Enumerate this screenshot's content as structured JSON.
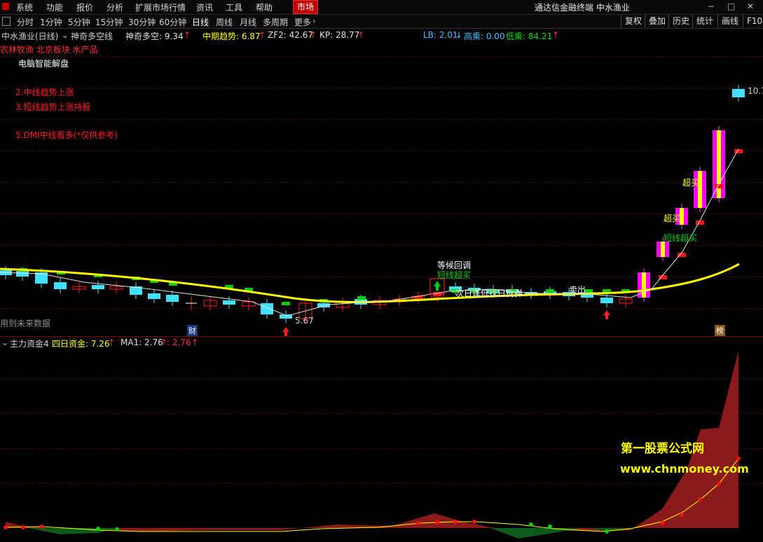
{
  "menu": {
    "items": [
      "系统",
      "功能",
      "报价",
      "分析",
      "扩展市场行情",
      "资讯",
      "工具",
      "帮助"
    ],
    "market": "市场",
    "app_title": "通达信金融终端  中水渔业"
  },
  "periods": [
    "分时",
    "1分钟",
    "5分钟",
    "15分钟",
    "30分钟",
    "60分钟",
    "日线",
    "周线",
    "月线",
    "多周期",
    "更多"
  ],
  "active_period": "日线",
  "right_tools": [
    "复权",
    "叠加",
    "历史",
    "统计",
    "画线",
    "F10"
  ],
  "stock": {
    "name": "中水渔业(日线)",
    "indicator": "神奇多空线",
    "shenqi": "神奇多空: 9.34",
    "zhongqi": "中期趋势: 6.87",
    "zf2": "ZF2: 42.67",
    "kp": "KP: 28.77",
    "lb": "LB: 2.01",
    "gaocheng": "高乘: 0.00",
    "dicheng": "低乘: 84.21",
    "sectors": "农林牧渔 北京板块 水产品"
  },
  "annotations": {
    "computer": "电脑智能解盘",
    "line2": "2.中线趋势上涨",
    "line3": "3.短线趋势上涨持股",
    "line5": "5.DMI中线看多(*仅供参考)",
    "future": "用到未来数据",
    "low_price": "5.67",
    "high_price": "10.7",
    "dengdai": "等候回调",
    "duanxian1": "短线超买",
    "ciri": "次日逢低找日反弹",
    "maichu": "卖出",
    "chaomai1": "超买",
    "chaomai2": "超买",
    "duanxian2": "短线超买",
    "cai_badge": "财",
    "bang_badge": "榜"
  },
  "sub": {
    "name": "主力资金4",
    "siri": "四日资金: 7.26",
    "ma1": "MA1: 2.76",
    "extra": ": 2.76"
  },
  "watermark": {
    "line1": "第一股票公式网",
    "line2": "www.chnmoney.com"
  },
  "colors": {
    "up": "#ff2020",
    "down": "#40e0ff",
    "ma": "#ffff00",
    "yang_fill": "#ff00ff",
    "green_mark": "#00d000",
    "bg": "#000000"
  }
}
